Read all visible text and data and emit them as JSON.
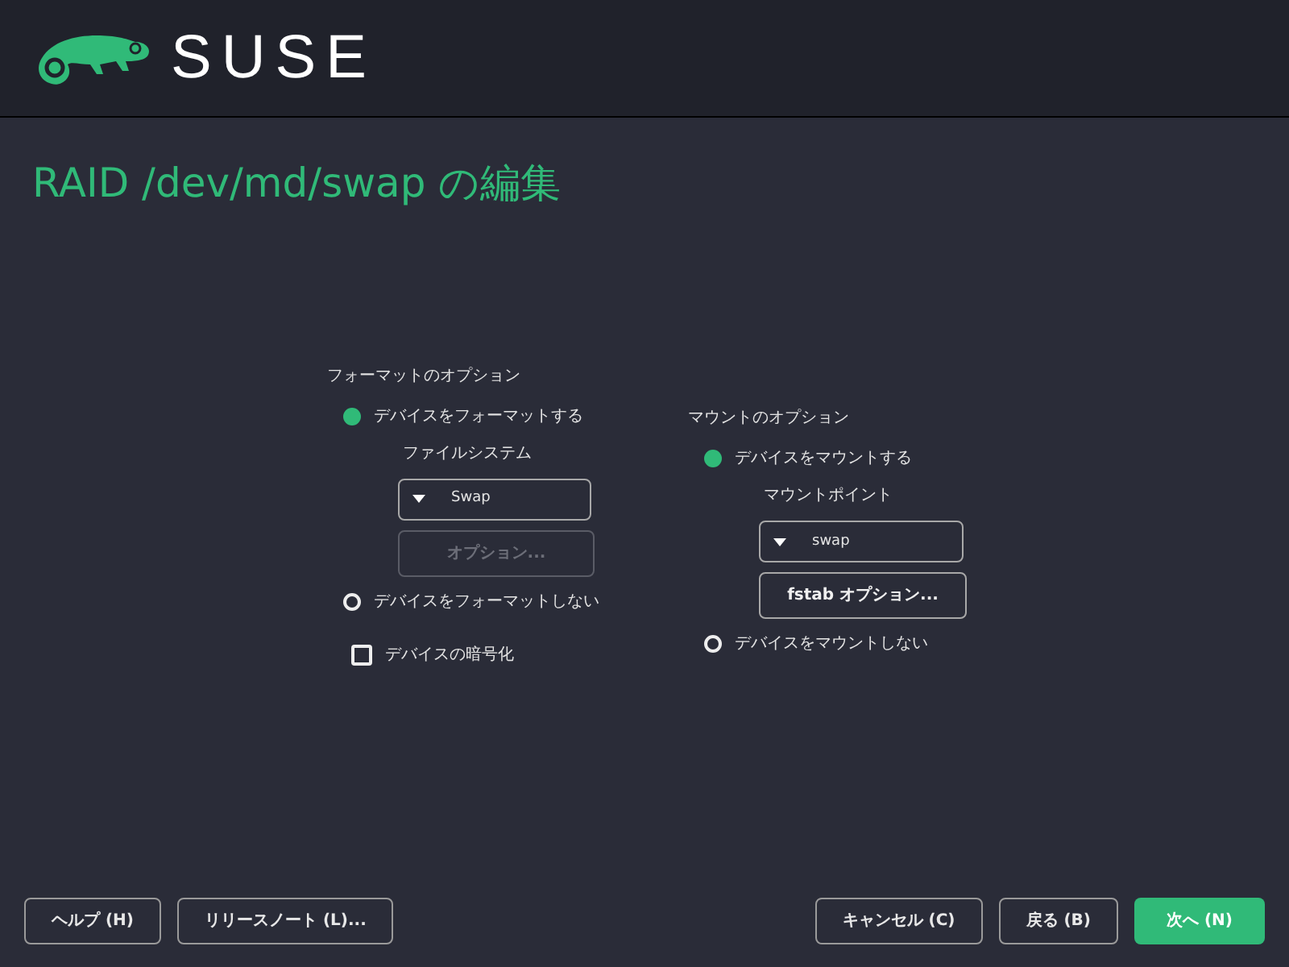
{
  "header": {
    "logo_text": "SUSE"
  },
  "title": "RAID /dev/md/swap の編集",
  "format": {
    "title": "フォーマットのオプション",
    "format_radio": {
      "label": "デバイスをフォーマットする",
      "selected": true
    },
    "filesystem": {
      "label": "ファイルシステム",
      "value": "Swap"
    },
    "options_button": {
      "label": "オプション...",
      "disabled": true
    },
    "no_format_radio": {
      "label": "デバイスをフォーマットしない",
      "selected": false
    },
    "encrypt": {
      "label": "デバイスの暗号化",
      "checked": false
    }
  },
  "mount": {
    "title": "マウントのオプション",
    "mount_radio": {
      "label": "デバイスをマウントする",
      "selected": true
    },
    "mount_point": {
      "label": "マウントポイント",
      "value": "swap"
    },
    "fstab_button": {
      "label": "fstab オプション...",
      "disabled": false
    },
    "no_mount_radio": {
      "label": "デバイスをマウントしない",
      "selected": false
    }
  },
  "footer": {
    "left": [
      {
        "label": "ヘルプ (H)",
        "kind": "plain"
      },
      {
        "label": "リリースノート (L)...",
        "kind": "plain"
      }
    ],
    "right": [
      {
        "label": "キャンセル (C)",
        "kind": "plain"
      },
      {
        "label": "戻る (B)",
        "kind": "plain"
      },
      {
        "label": "次へ (N)",
        "kind": "primary"
      }
    ]
  }
}
